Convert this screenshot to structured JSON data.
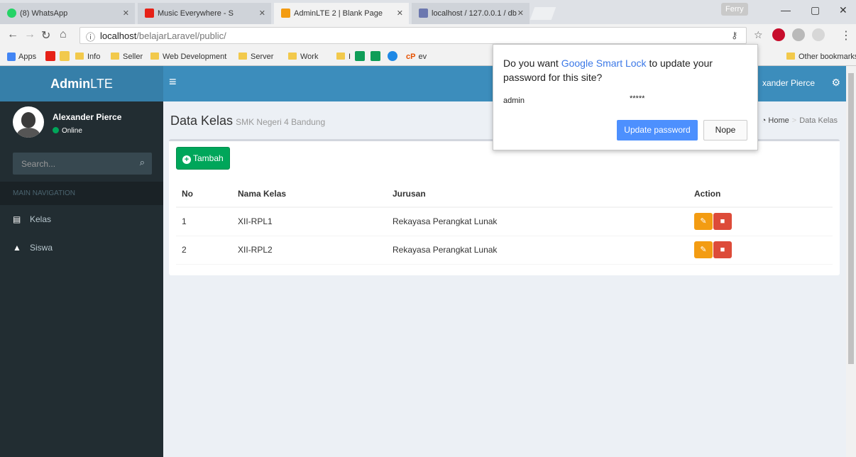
{
  "browser": {
    "tabs": [
      {
        "title": "(8) WhatsApp",
        "color": "#25d366"
      },
      {
        "title": "Music Everywhere - S",
        "color": "#e62117"
      },
      {
        "title": "AdminLTE 2 | Blank Page",
        "color": "#f39c12"
      },
      {
        "title": "localhost / 127.0.0.1 / db",
        "color": "#6c78af"
      }
    ],
    "profile": "Ferry",
    "url_host": "localhost",
    "url_path": "/belajarLaravel/public/",
    "bookmarks": [
      "Apps",
      "Info",
      "Seller",
      "Web Development",
      "Server",
      "Work",
      "I",
      "ev",
      "Other bookmarks"
    ]
  },
  "header": {
    "logo_bold": "Admin",
    "logo_rest": "LTE",
    "user_name": "xander Pierce"
  },
  "sidebar": {
    "user_name": "Alexander Pierce",
    "status": "Online",
    "search_placeholder": "Search...",
    "nav_header": "MAIN NAVIGATION",
    "items": [
      {
        "label": "Kelas"
      },
      {
        "label": "Siswa"
      }
    ]
  },
  "content": {
    "title": "Data Kelas",
    "subtitle": "SMK Negeri 4 Bandung",
    "breadcrumb_home": "Home",
    "breadcrumb_current": "Data Kelas",
    "add_button": "Tambah",
    "table": {
      "headers": [
        "No",
        "Nama Kelas",
        "Jurusan",
        "Action"
      ],
      "rows": [
        [
          "1",
          "XII-RPL1",
          "Rekayasa Perangkat Lunak"
        ],
        [
          "2",
          "XII-RPL2",
          "Rekayasa Perangkat Lunak"
        ]
      ]
    }
  },
  "popup": {
    "question_pre": "Do you want ",
    "question_link": "Google Smart Lock",
    "question_post": " to update your password for this site?",
    "username": "admin",
    "password_mask": "*****",
    "update_button": "Update password",
    "nope_button": "Nope"
  }
}
